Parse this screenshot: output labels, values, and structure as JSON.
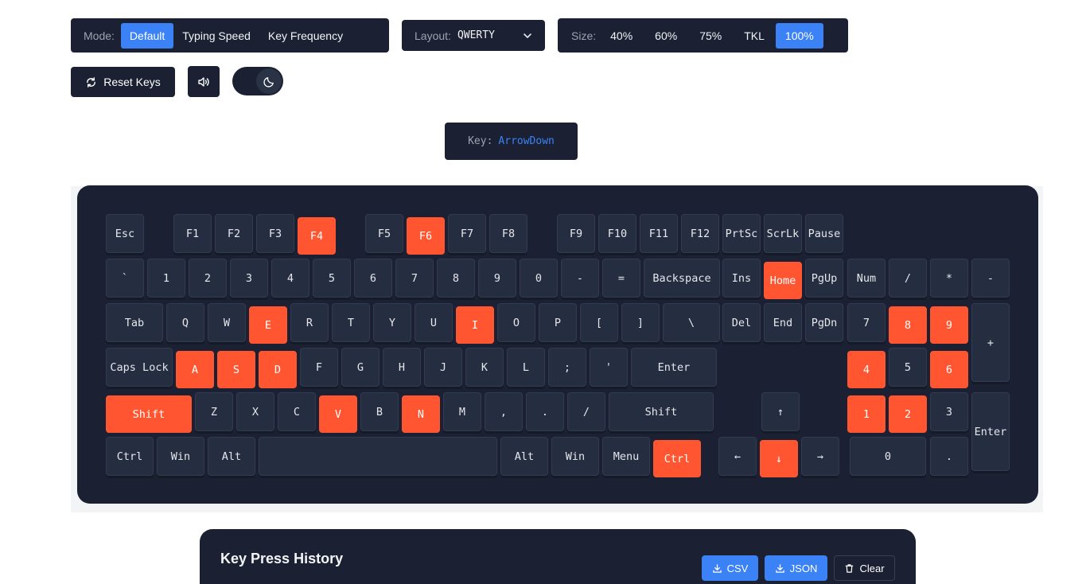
{
  "mode": {
    "label": "Mode:",
    "options": [
      "Default",
      "Typing Speed",
      "Key Frequency"
    ],
    "active": "Default"
  },
  "layout": {
    "label": "Layout:",
    "value": "QWERTY"
  },
  "size": {
    "label": "Size:",
    "options": [
      "40%",
      "60%",
      "75%",
      "TKL",
      "100%"
    ],
    "active": "100%"
  },
  "controls": {
    "reset_label": "Reset Keys",
    "sound_icon": "speaker-icon",
    "theme_icon": "moon-icon"
  },
  "key_display": {
    "label": "Key:",
    "value": "ArrowDown"
  },
  "colors": {
    "accent": "#3b82f6",
    "pressed": "#ff5631",
    "panel": "#1b2132",
    "key": "#252d40"
  },
  "keyboard": {
    "rows": [
      [
        {
          "label": "Esc",
          "pressed": false
        },
        {
          "label": "F1",
          "pressed": false
        },
        {
          "label": "F2",
          "pressed": false
        },
        {
          "label": "F3",
          "pressed": false
        },
        {
          "label": "F4",
          "pressed": true
        },
        {
          "label": "F5",
          "pressed": false
        },
        {
          "label": "F6",
          "pressed": true
        },
        {
          "label": "F7",
          "pressed": false
        },
        {
          "label": "F8",
          "pressed": false
        },
        {
          "label": "F9",
          "pressed": false
        },
        {
          "label": "F10",
          "pressed": false
        },
        {
          "label": "F11",
          "pressed": false
        },
        {
          "label": "F12",
          "pressed": false
        },
        {
          "label": "PrtSc",
          "pressed": false
        },
        {
          "label": "ScrLk",
          "pressed": false
        },
        {
          "label": "Pause",
          "pressed": false
        }
      ],
      [
        {
          "label": "`",
          "pressed": false
        },
        {
          "label": "1",
          "pressed": false
        },
        {
          "label": "2",
          "pressed": false
        },
        {
          "label": "3",
          "pressed": false
        },
        {
          "label": "4",
          "pressed": false
        },
        {
          "label": "5",
          "pressed": false
        },
        {
          "label": "6",
          "pressed": false
        },
        {
          "label": "7",
          "pressed": false
        },
        {
          "label": "8",
          "pressed": false
        },
        {
          "label": "9",
          "pressed": false
        },
        {
          "label": "0",
          "pressed": false
        },
        {
          "label": "-",
          "pressed": false
        },
        {
          "label": "=",
          "pressed": false
        },
        {
          "label": "Backspace",
          "pressed": false
        },
        {
          "label": "Ins",
          "pressed": false
        },
        {
          "label": "Home",
          "pressed": true
        },
        {
          "label": "PgUp",
          "pressed": false
        },
        {
          "label": "Num",
          "pressed": false
        },
        {
          "label": "/",
          "pressed": false
        },
        {
          "label": "*",
          "pressed": false
        },
        {
          "label": "-",
          "pressed": false
        }
      ],
      [
        {
          "label": "Tab",
          "pressed": false
        },
        {
          "label": "Q",
          "pressed": false
        },
        {
          "label": "W",
          "pressed": false
        },
        {
          "label": "E",
          "pressed": true
        },
        {
          "label": "R",
          "pressed": false
        },
        {
          "label": "T",
          "pressed": false
        },
        {
          "label": "Y",
          "pressed": false
        },
        {
          "label": "U",
          "pressed": false
        },
        {
          "label": "I",
          "pressed": true
        },
        {
          "label": "O",
          "pressed": false
        },
        {
          "label": "P",
          "pressed": false
        },
        {
          "label": "[",
          "pressed": false
        },
        {
          "label": "]",
          "pressed": false
        },
        {
          "label": "\\",
          "pressed": false
        },
        {
          "label": "Del",
          "pressed": false
        },
        {
          "label": "End",
          "pressed": false
        },
        {
          "label": "PgDn",
          "pressed": false
        },
        {
          "label": "7",
          "pressed": false
        },
        {
          "label": "8",
          "pressed": true
        },
        {
          "label": "9",
          "pressed": true
        },
        {
          "label": "+",
          "pressed": false
        }
      ],
      [
        {
          "label": "Caps Lock",
          "pressed": false
        },
        {
          "label": "A",
          "pressed": true
        },
        {
          "label": "S",
          "pressed": true
        },
        {
          "label": "D",
          "pressed": true
        },
        {
          "label": "F",
          "pressed": false
        },
        {
          "label": "G",
          "pressed": false
        },
        {
          "label": "H",
          "pressed": false
        },
        {
          "label": "J",
          "pressed": false
        },
        {
          "label": "K",
          "pressed": false
        },
        {
          "label": "L",
          "pressed": false
        },
        {
          "label": ";",
          "pressed": false
        },
        {
          "label": "'",
          "pressed": false
        },
        {
          "label": "Enter",
          "pressed": false
        },
        {
          "label": "4",
          "pressed": true
        },
        {
          "label": "5",
          "pressed": false
        },
        {
          "label": "6",
          "pressed": true
        }
      ],
      [
        {
          "label": "Shift",
          "pressed": true
        },
        {
          "label": "Z",
          "pressed": false
        },
        {
          "label": "X",
          "pressed": false
        },
        {
          "label": "C",
          "pressed": false
        },
        {
          "label": "V",
          "pressed": true
        },
        {
          "label": "B",
          "pressed": false
        },
        {
          "label": "N",
          "pressed": true
        },
        {
          "label": "M",
          "pressed": false
        },
        {
          "label": ",",
          "pressed": false
        },
        {
          "label": ".",
          "pressed": false
        },
        {
          "label": "/",
          "pressed": false
        },
        {
          "label": "Shift",
          "pressed": false
        },
        {
          "label": "↑",
          "pressed": false
        },
        {
          "label": "1",
          "pressed": true
        },
        {
          "label": "2",
          "pressed": true
        },
        {
          "label": "3",
          "pressed": false
        },
        {
          "label": "Enter",
          "pressed": false
        }
      ],
      [
        {
          "label": "Ctrl",
          "pressed": false
        },
        {
          "label": "Win",
          "pressed": false
        },
        {
          "label": "Alt",
          "pressed": false
        },
        {
          "label": "",
          "pressed": false
        },
        {
          "label": "Alt",
          "pressed": false
        },
        {
          "label": "Win",
          "pressed": false
        },
        {
          "label": "Menu",
          "pressed": false
        },
        {
          "label": "Ctrl",
          "pressed": true
        },
        {
          "label": "←",
          "pressed": false
        },
        {
          "label": "↓",
          "pressed": true
        },
        {
          "label": "→",
          "pressed": false
        },
        {
          "label": "0",
          "pressed": false
        },
        {
          "label": ".",
          "pressed": false
        }
      ]
    ]
  },
  "history": {
    "title": "Key Press History",
    "csv_label": "CSV",
    "json_label": "JSON",
    "clear_label": "Clear"
  }
}
